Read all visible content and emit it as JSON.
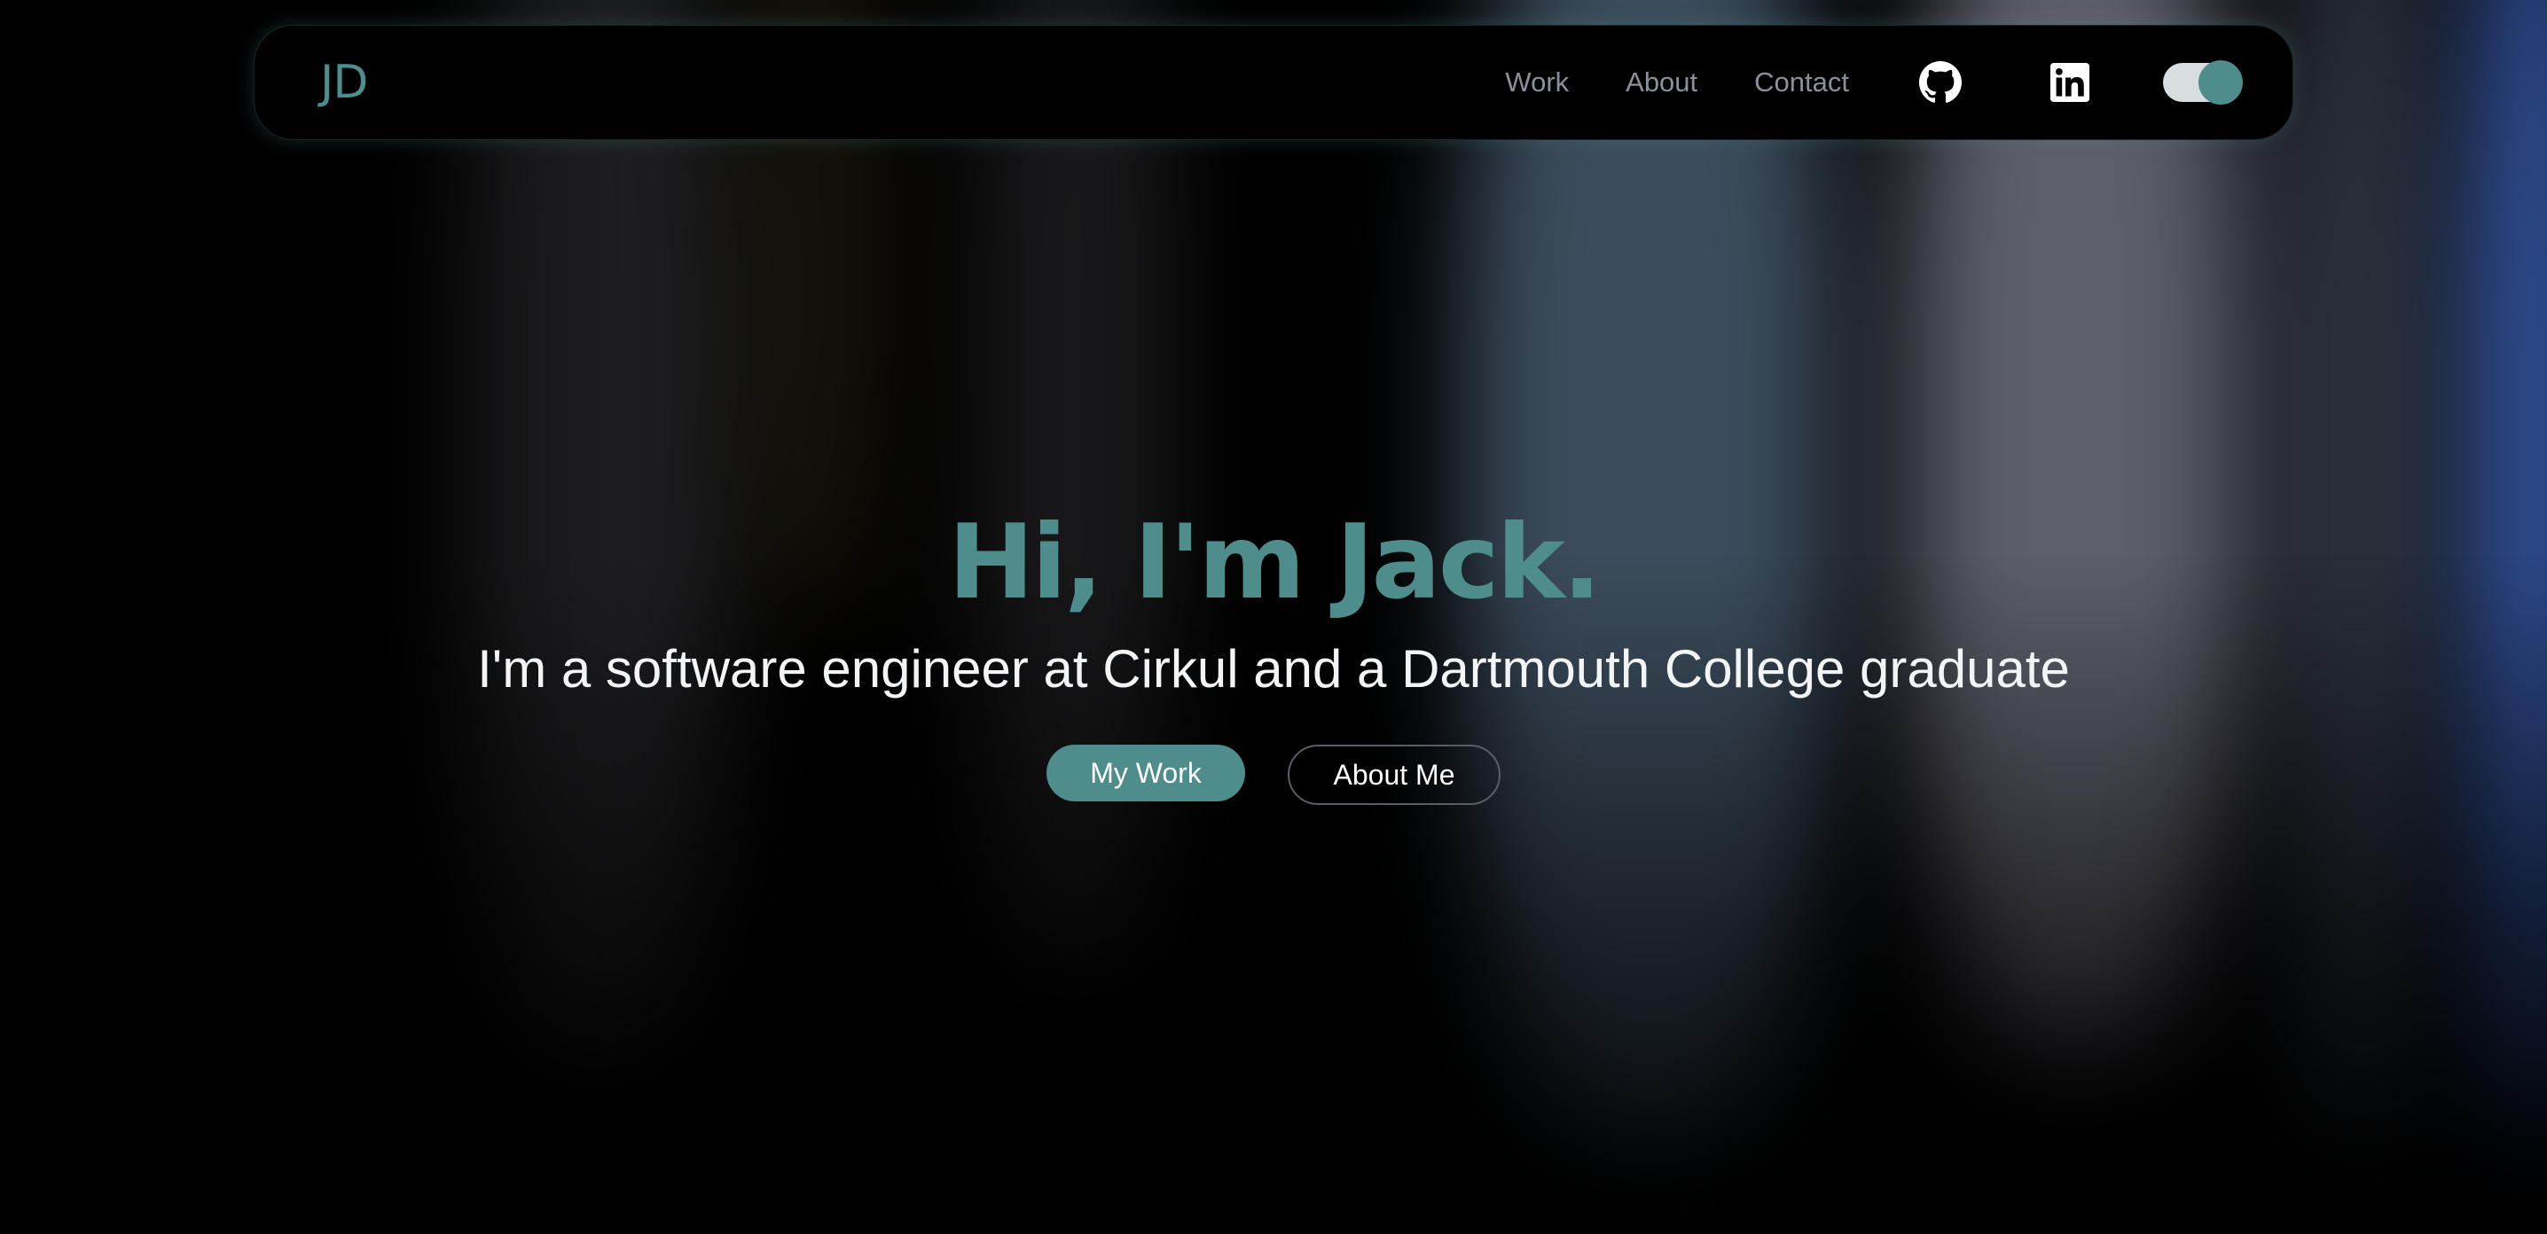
{
  "brand": {
    "logo_text": "JD",
    "accent_color": "#4f8c8c"
  },
  "nav": {
    "links": [
      {
        "label": "Work"
      },
      {
        "label": "About"
      },
      {
        "label": "Contact"
      }
    ],
    "icons": [
      {
        "name": "github-icon"
      },
      {
        "name": "linkedin-icon"
      }
    ],
    "theme_toggle": {
      "state": "on"
    }
  },
  "hero": {
    "title": "Hi, I'm Jack.",
    "subtitle": "I'm a software engineer at Cirkul and a Dartmouth College graduate",
    "primary_button": "My Work",
    "secondary_button": "About Me"
  }
}
